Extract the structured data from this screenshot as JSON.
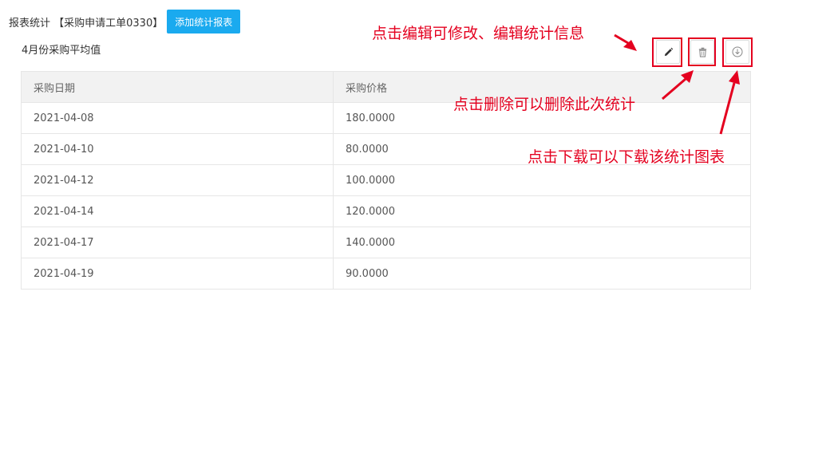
{
  "header": {
    "title": "报表统计 【采购申请工单0330】",
    "add_button_label": "添加统计报表"
  },
  "report": {
    "title": "4月份采购平均值"
  },
  "toolbar": {
    "edit_icon": "pencil-icon",
    "delete_icon": "trash-icon",
    "download_icon": "download-circle-icon"
  },
  "table": {
    "columns": [
      "采购日期",
      "采购价格"
    ],
    "rows": [
      [
        "2021-04-08",
        "180.0000"
      ],
      [
        "2021-04-10",
        "80.0000"
      ],
      [
        "2021-04-12",
        "100.0000"
      ],
      [
        "2021-04-14",
        "120.0000"
      ],
      [
        "2021-04-17",
        "140.0000"
      ],
      [
        "2021-04-19",
        "90.0000"
      ]
    ]
  },
  "annotations": {
    "edit": "点击编辑可修改、编辑统计信息",
    "delete": "点击删除可以删除此次统计",
    "download": "点击下载可以下载该统计图表"
  },
  "colors": {
    "accent": "#1aaaef",
    "annotation": "#e4001f",
    "header_bg": "#f2f2f2",
    "border": "#e6e6e6"
  }
}
